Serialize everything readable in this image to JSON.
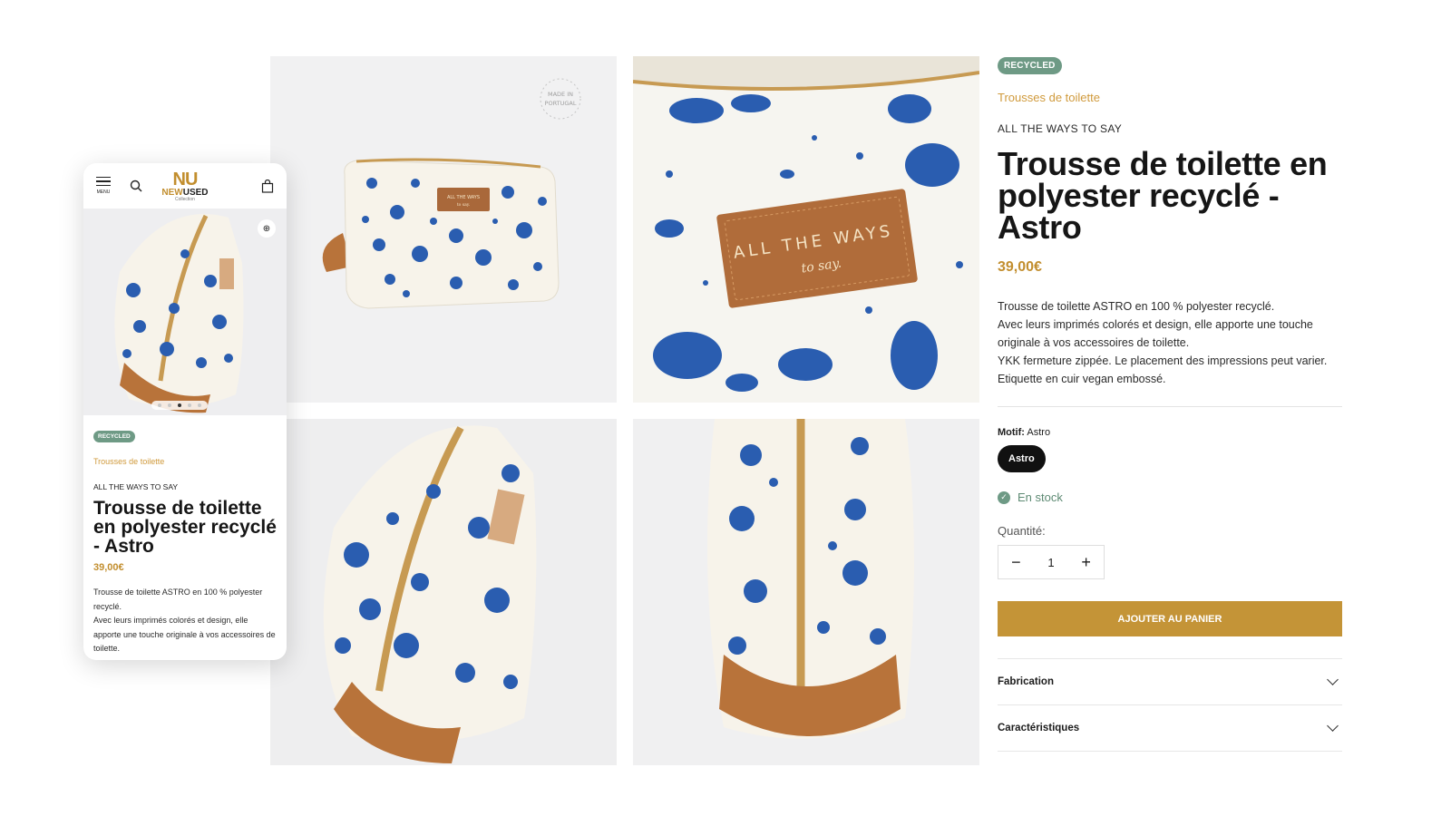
{
  "product": {
    "badge": "RECYCLED",
    "category": "Trousses de toilette",
    "brand": "ALL THE WAYS TO SAY",
    "title": "Trousse de toilette en polyester recyclé - Astro",
    "price": "39,00€",
    "description": [
      "Trousse de toilette ASTRO en 100 % polyester recyclé.",
      "Avec leurs imprimés colorés et design, elle apporte une touche originale à vos accessoires de toilette.",
      "YKK fermeture zippée. Le placement des impressions peut varier. Etiquette en cuir vegan embossé."
    ],
    "motif_label": "Motif:",
    "motif_value": "Astro",
    "swatch": "Astro",
    "stock": "En stock",
    "quantity_label": "Quantité:",
    "quantity": "1",
    "minus": "−",
    "plus": "+",
    "add_to_cart": "AJOUTER AU PANIER",
    "accordions": [
      "Fabrication",
      "Caractéristiques"
    ]
  },
  "gallery": {
    "stamp": "MADE IN PORTUGAL",
    "label_line1": "ALL THE WAYS",
    "label_line2": "to say."
  },
  "mobile": {
    "menu_label": "MENU",
    "logo_top": "NU",
    "logo_new": "NEW",
    "logo_used": "USED",
    "logo_sub": "Collection",
    "badge": "RECYCLED",
    "category": "Trousses de toilette",
    "brand": "ALL THE WAYS TO SAY",
    "title": "Trousse de toilette en polyester recyclé - Astro",
    "price": "39,00€",
    "description": [
      "Trousse de toilette ASTRO en 100 % polyester recyclé.",
      "Avec leurs imprimés colorés et design, elle apporte une touche originale à vos accessoires de toilette."
    ]
  },
  "colors": {
    "accent_gold": "#c49437",
    "badge_green": "#6e9a85",
    "print_blue": "#2a5db0",
    "leather_brown": "#b8733a"
  }
}
